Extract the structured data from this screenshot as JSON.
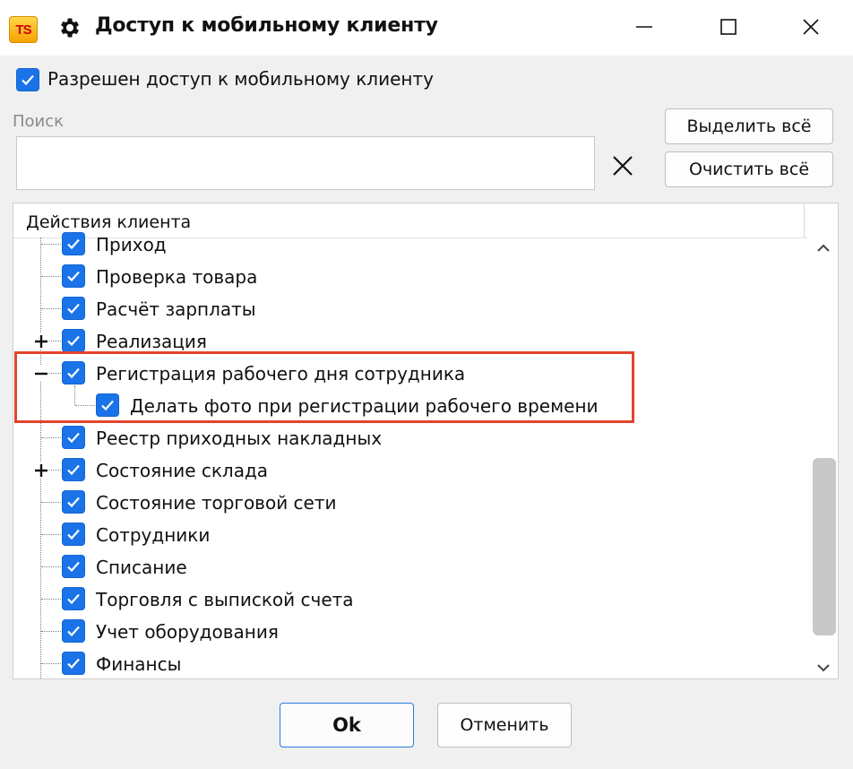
{
  "window": {
    "logo_text": "TS",
    "title": "Доступ к мобильному клиенту",
    "icons": [
      "gear-icon",
      "minimize-icon",
      "maximize-icon",
      "close-icon"
    ]
  },
  "access": {
    "checked": true,
    "label": "Разрешен доступ к мобильному клиенту"
  },
  "search": {
    "label": "Поиск",
    "value": "",
    "placeholder": ""
  },
  "buttons": {
    "select_all": "Выделить всё",
    "clear_all": "Очистить всё",
    "ok": "Ok",
    "cancel": "Отменить"
  },
  "tree": {
    "header": "Действия клиента",
    "items": [
      {
        "label": "Приход",
        "checked": true,
        "level": 0,
        "expander": ""
      },
      {
        "label": "Проверка товара",
        "checked": true,
        "level": 0,
        "expander": ""
      },
      {
        "label": "Расчёт зарплаты",
        "checked": true,
        "level": 0,
        "expander": ""
      },
      {
        "label": "Реализация",
        "checked": true,
        "level": 0,
        "expander": "plus"
      },
      {
        "label": "Регистрация рабочего дня сотрудника",
        "checked": true,
        "level": 0,
        "expander": "minus"
      },
      {
        "label": "Делать фото при регистрации рабочего времени",
        "checked": true,
        "level": 1,
        "expander": ""
      },
      {
        "label": "Реестр приходных накладных",
        "checked": true,
        "level": 0,
        "expander": ""
      },
      {
        "label": "Состояние склада",
        "checked": true,
        "level": 0,
        "expander": "plus"
      },
      {
        "label": "Состояние торговой сети",
        "checked": true,
        "level": 0,
        "expander": ""
      },
      {
        "label": "Сотрудники",
        "checked": true,
        "level": 0,
        "expander": ""
      },
      {
        "label": "Списание",
        "checked": true,
        "level": 0,
        "expander": ""
      },
      {
        "label": "Торговля с выпиской счета",
        "checked": true,
        "level": 0,
        "expander": ""
      },
      {
        "label": "Учет оборудования",
        "checked": true,
        "level": 0,
        "expander": ""
      },
      {
        "label": "Финансы",
        "checked": true,
        "level": 0,
        "expander": ""
      }
    ]
  },
  "colors": {
    "checkbox": "#1a73e8",
    "highlight": "#e2452e",
    "ok_border": "#2a7bdc"
  }
}
